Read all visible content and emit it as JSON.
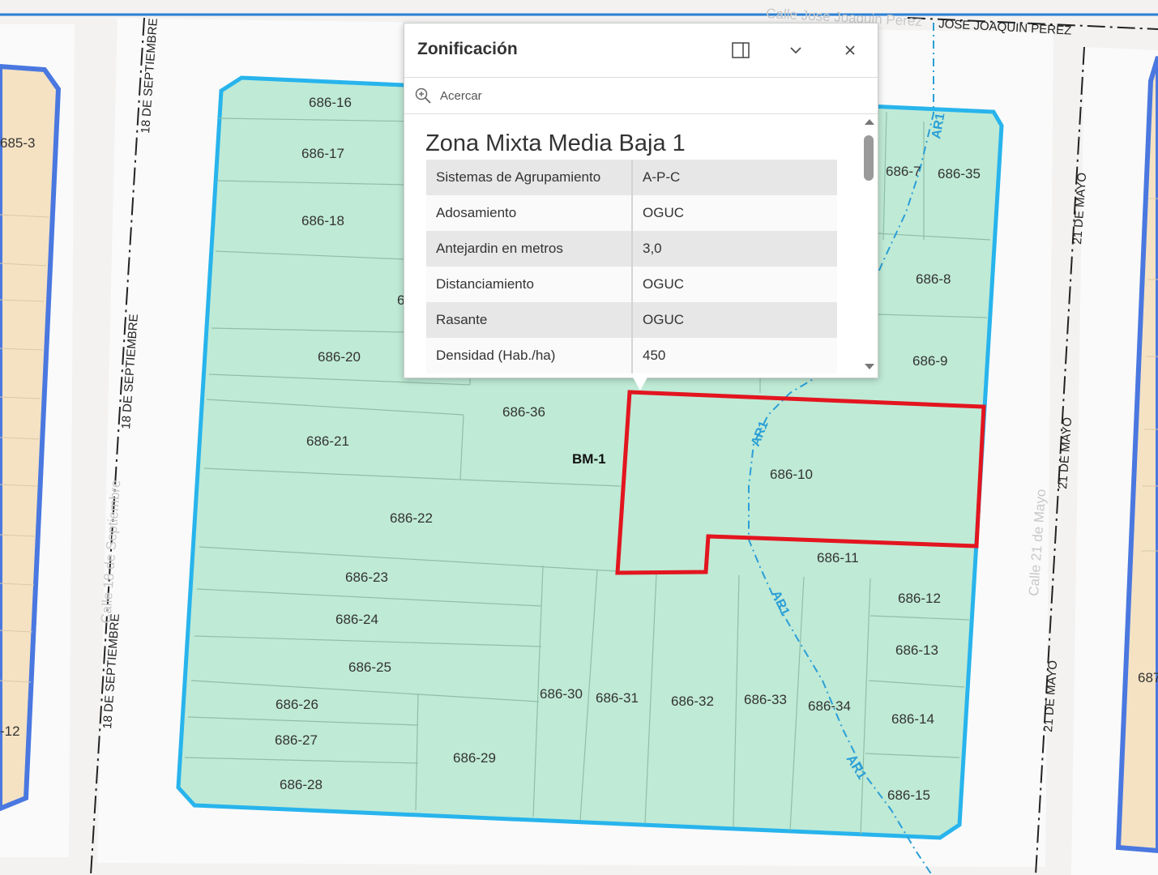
{
  "popup": {
    "title": "Zonificación",
    "zoom_label": "Acercar",
    "zone_name": "Zona Mixta Media Baja 1",
    "attributes": [
      {
        "key": "Sistemas de Agrupamiento",
        "value": "A-P-C"
      },
      {
        "key": "Adosamiento",
        "value": "OGUC"
      },
      {
        "key": "Antejardin en metros",
        "value": "3,0"
      },
      {
        "key": "Distanciamiento",
        "value": "OGUC"
      },
      {
        "key": "Rasante",
        "value": "OGUC"
      },
      {
        "key": "Densidad (Hab./ha)",
        "value": "450"
      }
    ],
    "icons": {
      "dock": "dock-side-icon",
      "collapse": "chevron-down-icon",
      "close": "close-icon",
      "zoom": "zoom-in-icon"
    }
  },
  "map": {
    "zone_code": "BM-1",
    "route_code": "AR1",
    "streets": {
      "north": "JOSE JOAQUIN PEREZ",
      "north_faded": "Calle Jose Joaquin Perez",
      "west": "18 DE SEPTIEMBRE",
      "west_faded": "Calle 18 de Septiembre",
      "east": "21 DE MAYO",
      "east_faded": "Calle 21 de Mayo"
    },
    "lots": {
      "l16": "686-16",
      "l17": "686-17",
      "l18": "686-18",
      "l19": "6",
      "l20": "686-20",
      "l21": "686-21",
      "l22": "686-22",
      "l23": "686-23",
      "l24": "686-24",
      "l25": "686-25",
      "l26": "686-26",
      "l27": "686-27",
      "l28": "686-28",
      "l29": "686-29",
      "l30": "686-30",
      "l31": "686-31",
      "l32": "686-32",
      "l33": "686-33",
      "l34": "686-34",
      "l14": "686-14",
      "l15": "686-15",
      "l13": "686-13",
      "l12": "686-12",
      "l11": "686-11",
      "l10": "686-10",
      "l9": "686-9",
      "l8": "686-8",
      "l7": "686-7",
      "l35": "686-35",
      "l36": "686-36"
    },
    "neighbor_lots": {
      "w1": "685-3",
      "w2": "-12",
      "e1": "687"
    },
    "colors": {
      "zone_fill": "#bfead6",
      "zone_border": "#28b4ec",
      "selection": "#e3151f",
      "neighbor_fill": "#f5e2c3",
      "neighbor_border": "#4a78e0",
      "route": "#2a9fd6"
    }
  }
}
